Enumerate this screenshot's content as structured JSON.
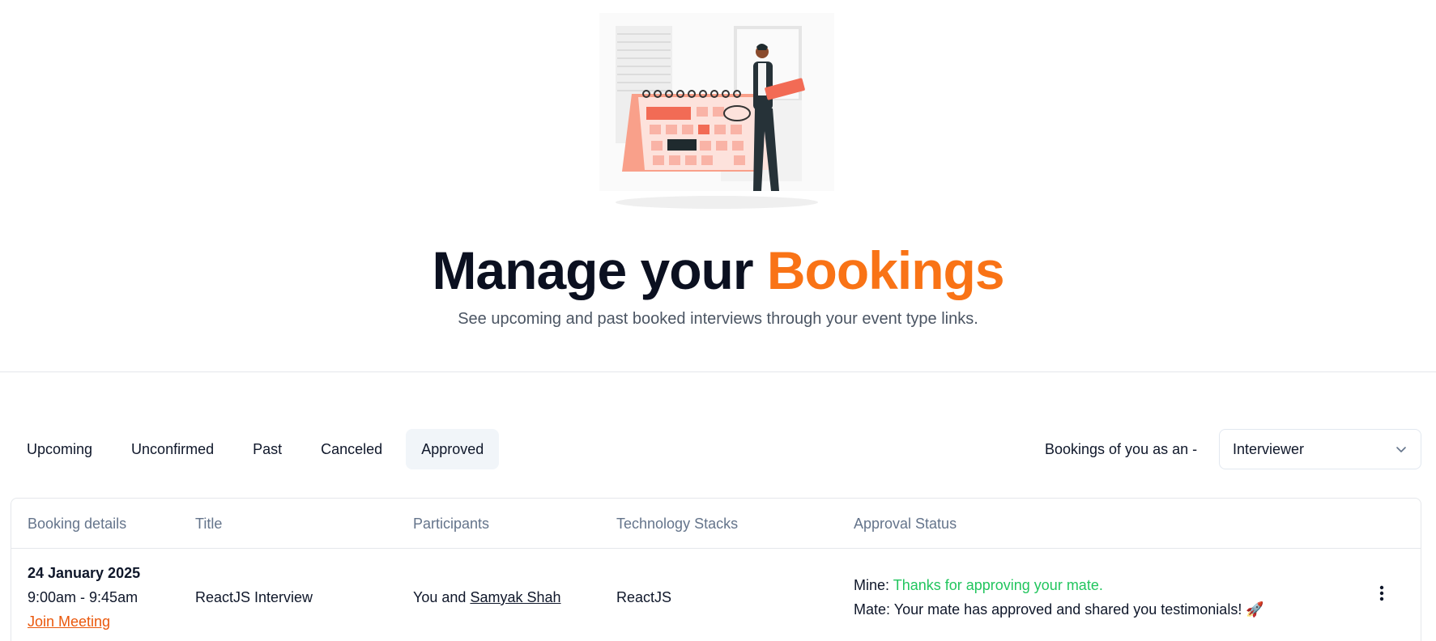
{
  "hero": {
    "title_part1": "Manage your",
    "title_part2": "Bookings",
    "subtitle": "See upcoming and past booked interviews through your event type links.",
    "accent_color": "#f97316"
  },
  "tabs": [
    {
      "label": "Upcoming",
      "active": false
    },
    {
      "label": "Unconfirmed",
      "active": false
    },
    {
      "label": "Past",
      "active": false
    },
    {
      "label": "Canceled",
      "active": false
    },
    {
      "label": "Approved",
      "active": true
    }
  ],
  "role_filter": {
    "label": "Bookings of you as an -",
    "selected": "Interviewer",
    "icon": "chevron-down-icon"
  },
  "table": {
    "headers": [
      "Booking details",
      "Title",
      "Participants",
      "Technology Stacks",
      "Approval Status"
    ],
    "rows": [
      {
        "date": "24 January 2025",
        "time": "9:00am - 9:45am",
        "join_label": "Join Meeting",
        "title": "ReactJS Interview",
        "participants_prefix": "You and",
        "participant_name": "Samyak Shah",
        "tech": "ReactJS",
        "mine_label": "Mine:",
        "mine_status": "Thanks for approving your mate.",
        "mate_label": "Mate:",
        "mate_status": "Your mate has approved and shared you testimonials! 🚀",
        "actions_icon": "kebab-menu-icon"
      }
    ]
  }
}
